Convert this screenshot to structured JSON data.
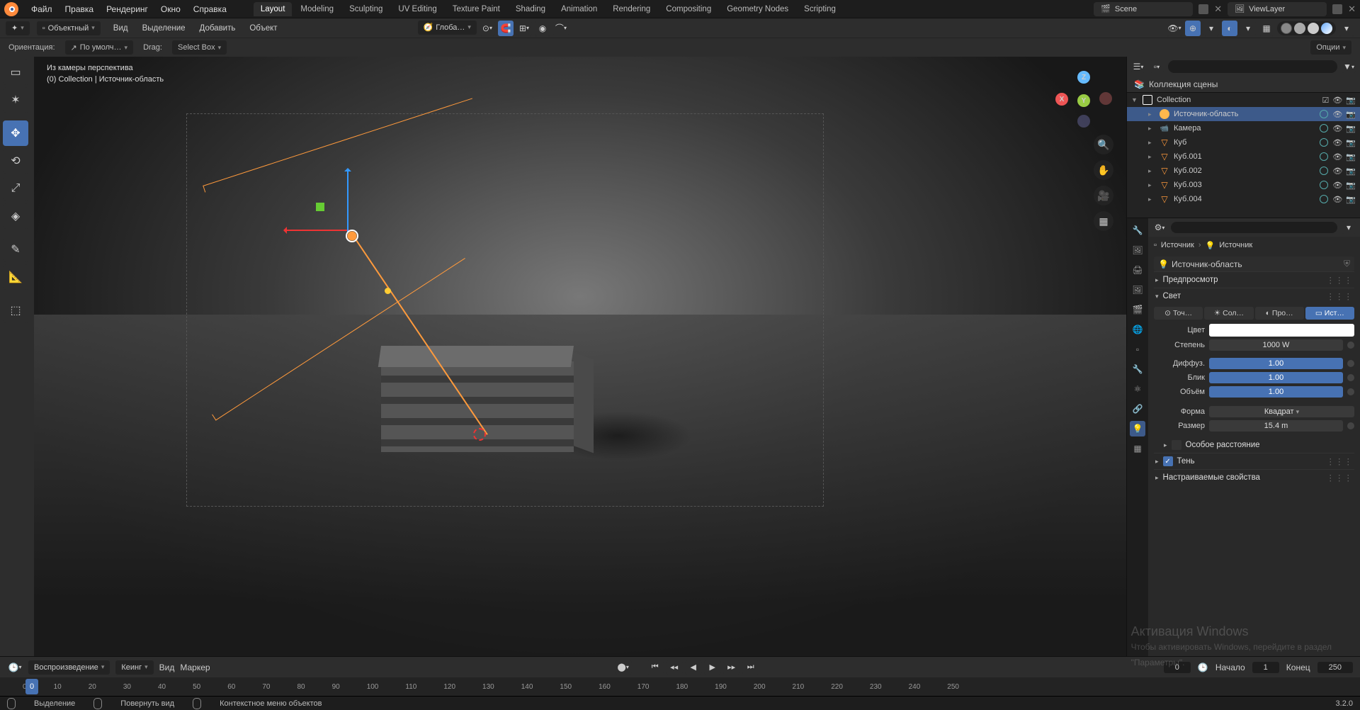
{
  "top": {
    "menus": [
      "Файл",
      "Правка",
      "Рендеринг",
      "Окно",
      "Справка"
    ],
    "tabs": [
      "Layout",
      "Modeling",
      "Sculpting",
      "UV Editing",
      "Texture Paint",
      "Shading",
      "Animation",
      "Rendering",
      "Compositing",
      "Geometry Nodes",
      "Scripting"
    ],
    "active_tab": 0,
    "scene": "Scene",
    "layer": "ViewLayer"
  },
  "hdr2": {
    "mode": "Объектный",
    "menus": [
      "Вид",
      "Выделение",
      "Добавить",
      "Объект"
    ],
    "transform": "Глоба…"
  },
  "hdr3": {
    "orient_label": "Ориентация:",
    "orient_val": "По умолч…",
    "drag_label": "Drag:",
    "drag_val": "Select Box",
    "options": "Опции"
  },
  "viewport": {
    "line1": "Из камеры перспектива",
    "line2": "(0) Collection | Источник-область"
  },
  "outliner": {
    "title": "Коллекция сцены",
    "collection": "Collection",
    "items": [
      {
        "icon": "lamp",
        "name": "Источник-область",
        "sel": true
      },
      {
        "icon": "cam",
        "name": "Камера",
        "sel": false
      },
      {
        "icon": "mesh",
        "name": "Куб",
        "sel": false
      },
      {
        "icon": "mesh",
        "name": "Куб.001",
        "sel": false
      },
      {
        "icon": "mesh",
        "name": "Куб.002",
        "sel": false
      },
      {
        "icon": "mesh",
        "name": "Куб.003",
        "sel": false
      },
      {
        "icon": "mesh",
        "name": "Куб.004",
        "sel": false
      }
    ]
  },
  "props": {
    "breadcrumb1": "Источник",
    "breadcrumb2": "Источник",
    "obj_field": "Источник-область",
    "preview": "Предпросмотр",
    "light": "Свет",
    "types": [
      "Точ…",
      "Сол…",
      "Про…",
      "Ист…"
    ],
    "active_type": 3,
    "color": "Цвет",
    "power": "Степень",
    "power_val": "1000 W",
    "diffuse": "Диффуз.",
    "diffuse_val": "1.00",
    "spec": "Блик",
    "spec_val": "1.00",
    "vol": "Объём",
    "vol_val": "1.00",
    "shape": "Форма",
    "shape_val": "Квадрат",
    "size": "Размер",
    "size_val": "15.4 m",
    "dist": "Особое расстояние",
    "shadow": "Тень",
    "custom": "Настраиваемые свойства"
  },
  "timeline": {
    "menus": [
      "Воспроизведение",
      "Кеинг",
      "Вид",
      "Маркер"
    ],
    "start_lbl": "Начало",
    "start": "1",
    "end_lbl": "Конец",
    "end": "250",
    "frame": "0",
    "cur": "0",
    "ticks": [
      "0",
      "10",
      "20",
      "30",
      "40",
      "50",
      "60",
      "70",
      "80",
      "90",
      "100",
      "110",
      "120",
      "130",
      "140",
      "150",
      "160",
      "170",
      "180",
      "190",
      "200",
      "210",
      "220",
      "230",
      "240",
      "250"
    ]
  },
  "status": {
    "select": "Выделение",
    "rotate": "Повернуть вид",
    "ctx": "Контекстное меню объектов",
    "version": "3.2.0"
  },
  "watermark": {
    "l1": "Активация Windows",
    "l2": "Чтобы активировать Windows, перейдите в раздел",
    "l3": "\"Параметры\"."
  }
}
